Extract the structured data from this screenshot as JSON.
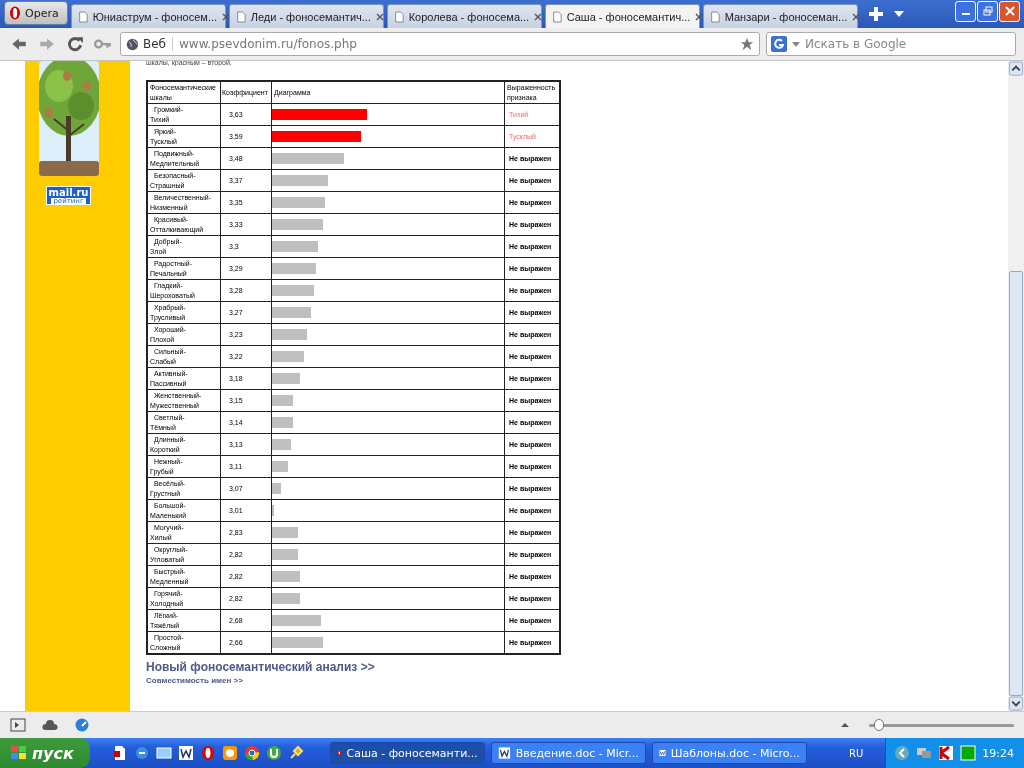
{
  "browser": {
    "menu_button": "Opera",
    "tabs": [
      {
        "label": "Юниаструм - фоносем...",
        "selected": false
      },
      {
        "label": "Леди - фоносемантич...",
        "selected": false
      },
      {
        "label": "Королева - фоносема...",
        "selected": false
      },
      {
        "label": "Саша - фоносемантич...",
        "selected": true
      },
      {
        "label": "Манзари - фоносеман...",
        "selected": false
      }
    ],
    "address": {
      "badge": "Веб",
      "url": "www.psevdonim.ru/fonos.php"
    },
    "search": {
      "placeholder": "Искать в Google"
    }
  },
  "sidebar": {
    "logo": {
      "title": "mail.ru",
      "subtitle": "рейтинг"
    }
  },
  "page": {
    "intro": "шкалы, красным – второй.",
    "table": {
      "columns": [
        "Фоносемантические шкалы",
        "Коэффициент",
        "Диаграмма",
        "Выраженность признака"
      ],
      "rows": [
        {
          "scale": "Громкий-Тихий",
          "coefficient": "3,63",
          "level": 0.41,
          "expressed": true,
          "verdict": "Тихий"
        },
        {
          "scale": "Яркий-Тусклый",
          "coefficient": "3,59",
          "level": 0.385,
          "expressed": true,
          "verdict": "Тусклый"
        },
        {
          "scale": "Подвижный-Медлительный",
          "coefficient": "3,48",
          "level": 0.31,
          "expressed": false,
          "verdict": "Не выражен"
        },
        {
          "scale": "Безопасный-Страшный",
          "coefficient": "3,37",
          "level": 0.24,
          "expressed": false,
          "verdict": "Не выражен"
        },
        {
          "scale": "Величественный-Низменный",
          "coefficient": "3,35",
          "level": 0.23,
          "expressed": false,
          "verdict": "Не выражен"
        },
        {
          "scale": "Красивый-Отталкивающий",
          "coefficient": "3,33",
          "level": 0.22,
          "expressed": false,
          "verdict": "Не выражен"
        },
        {
          "scale": "Добрый-Злой",
          "coefficient": "3,3",
          "level": 0.2,
          "expressed": false,
          "verdict": "Не выражен"
        },
        {
          "scale": "Радостный-Печальный",
          "coefficient": "3,29",
          "level": 0.19,
          "expressed": false,
          "verdict": "Не выражен"
        },
        {
          "scale": "Гладкий-Шероховатый",
          "coefficient": "3,28",
          "level": 0.18,
          "expressed": false,
          "verdict": "Не выражен"
        },
        {
          "scale": "Храбрый-Трусливый",
          "coefficient": "3,27",
          "level": 0.17,
          "expressed": false,
          "verdict": "Не выражен"
        },
        {
          "scale": "Хороший-Плохой",
          "coefficient": "3,23",
          "level": 0.15,
          "expressed": false,
          "verdict": "Не выражен"
        },
        {
          "scale": "Сильный-Слабый",
          "coefficient": "3,22",
          "level": 0.14,
          "expressed": false,
          "verdict": "Не выражен"
        },
        {
          "scale": "Активный-Пассивный",
          "coefficient": "3,18",
          "level": 0.12,
          "expressed": false,
          "verdict": "Не выражен"
        },
        {
          "scale": "Женственный-Мужественный",
          "coefficient": "3,15",
          "level": 0.09,
          "expressed": false,
          "verdict": "Не выражен"
        },
        {
          "scale": "Светлый-Тёмный",
          "coefficient": "3,14",
          "level": 0.09,
          "expressed": false,
          "verdict": "Не выражен"
        },
        {
          "scale": "Длинный-Короткий",
          "coefficient": "3,13",
          "level": 0.08,
          "expressed": false,
          "verdict": "Не выражен"
        },
        {
          "scale": "Нежный-Грубый",
          "coefficient": "3,11",
          "level": 0.07,
          "expressed": false,
          "verdict": "Не выражен"
        },
        {
          "scale": "Весёлый-Грустный",
          "coefficient": "3,07",
          "level": 0.04,
          "expressed": false,
          "verdict": "Не выражен"
        },
        {
          "scale": "Большой-Маленький",
          "coefficient": "3,01",
          "level": 0.01,
          "expressed": false,
          "verdict": "Не выражен"
        },
        {
          "scale": "Могучий-Хилый",
          "coefficient": "2,83",
          "level": 0.11,
          "expressed": false,
          "verdict": "Не выражен"
        },
        {
          "scale": "Округлый-Угловатый",
          "coefficient": "2,82",
          "level": 0.11,
          "expressed": false,
          "verdict": "Не выражен"
        },
        {
          "scale": "Быстрый-Медленный",
          "coefficient": "2,82",
          "level": 0.12,
          "expressed": false,
          "verdict": "Не выражен"
        },
        {
          "scale": "Горячий-Холодный",
          "coefficient": "2,82",
          "level": 0.12,
          "expressed": false,
          "verdict": "Не выражен"
        },
        {
          "scale": "Лёгкий-Тяжёлый",
          "coefficient": "2,68",
          "level": 0.21,
          "expressed": false,
          "verdict": "Не выражен"
        },
        {
          "scale": "Простой-Сложный",
          "coefficient": "2,66",
          "level": 0.22,
          "expressed": false,
          "verdict": "Не выражен"
        }
      ]
    },
    "links": [
      "Новый фоносемантический анализ >>",
      "Совместимость имен >>"
    ]
  },
  "status_bar": {
    "zoom": {
      "level": 0.07
    }
  },
  "taskbar": {
    "start": "пуск",
    "tasks": [
      {
        "label": "Саша - фоносеманти...",
        "selected": true
      },
      {
        "label": "Введение.doc - Micr...",
        "selected": false
      },
      {
        "label": "Шаблоны.doc - Micro...",
        "selected": false
      }
    ],
    "language": "RU",
    "clock": "19:24"
  }
}
